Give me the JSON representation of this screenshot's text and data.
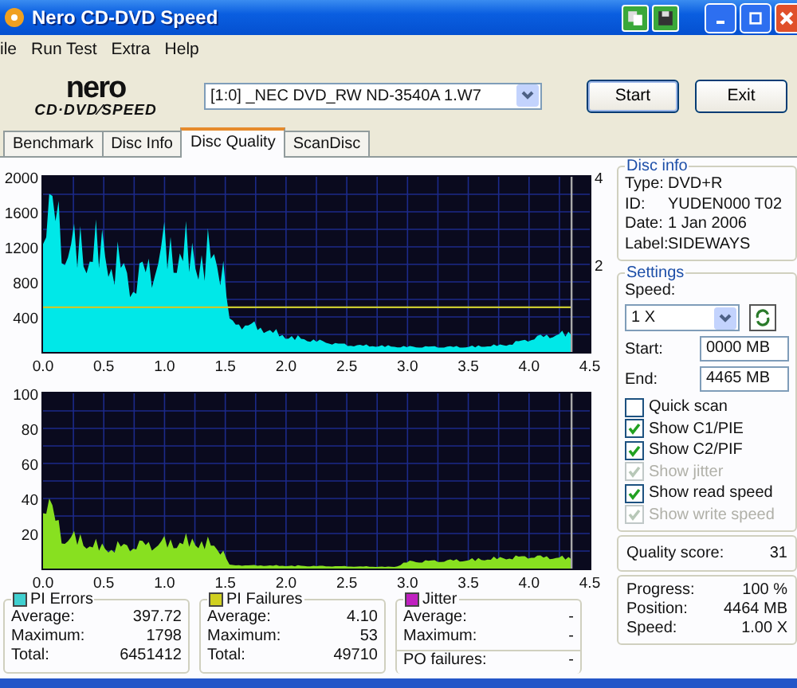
{
  "window": {
    "title": "Nero CD-DVD Speed"
  },
  "menu": [
    "ile",
    "Run Test",
    "Extra",
    "Help"
  ],
  "toolbar": {
    "logo_top": "nero",
    "logo_bottom": "CD·DVD⁄SPEED",
    "drive": "[1:0]  _NEC DVD_RW ND-3540A 1.W7",
    "buttons": [
      "Start",
      "Exit"
    ]
  },
  "tabs": [
    {
      "label": "Benchmark",
      "selected": false
    },
    {
      "label": "Disc Info",
      "selected": false
    },
    {
      "label": "Disc Quality",
      "selected": true
    },
    {
      "label": "ScanDisc",
      "selected": false
    }
  ],
  "graphs": [
    {
      "kind": "errors",
      "y_labels": [
        "2000",
        "1600",
        "1200",
        "800",
        "400"
      ],
      "right_labels": [
        "4",
        "2"
      ],
      "x_labels": [
        "0.0",
        "0.5",
        "1.0",
        "1.5",
        "2.0",
        "2.5",
        "3.0",
        "3.5",
        "4.0",
        "4.5"
      ]
    },
    {
      "kind": "failures",
      "y_labels": [
        "100",
        "80",
        "60",
        "40",
        "20"
      ],
      "x_labels": [
        "0.0",
        "0.5",
        "1.0",
        "1.5",
        "2.0",
        "2.5",
        "3.0",
        "3.5",
        "4.0",
        "4.5"
      ]
    }
  ],
  "stats": [
    {
      "title": "PI Errors",
      "color": "#40d0d0",
      "rows": [
        {
          "label": "Average:",
          "value": "397.72"
        },
        {
          "label": "Maximum:",
          "value": "1798"
        },
        {
          "label": "Total:",
          "value": "6451412"
        }
      ]
    },
    {
      "title": "PI Failures",
      "color": "#d0d020",
      "rows": [
        {
          "label": "Average:",
          "value": "4.10"
        },
        {
          "label": "Maximum:",
          "value": "53"
        },
        {
          "label": "Total:",
          "value": "49710"
        }
      ]
    },
    {
      "title": "Jitter",
      "color": "#c020c0",
      "rows": [
        {
          "label": "Average:",
          "value": "-"
        },
        {
          "label": "Maximum:",
          "value": "-"
        }
      ],
      "extra": {
        "label": "PO failures:",
        "value": "-"
      }
    }
  ],
  "disc_info": {
    "title": "Disc info",
    "rows": [
      {
        "label": "Type:",
        "value": "DVD+R"
      },
      {
        "label": "ID:",
        "value": "YUDEN000 T02"
      },
      {
        "label": "Date:",
        "value": "1 Jan 2006"
      },
      {
        "label": "Label:",
        "value": "SIDEWAYS"
      }
    ]
  },
  "settings": {
    "title": "Settings",
    "speed_label": "Speed:",
    "speed": "1 X",
    "start_label": "Start:",
    "start": "0000 MB",
    "end_label": "End:",
    "end": "4465 MB",
    "options": [
      {
        "label": "Quick scan",
        "checked": false,
        "disabled": false
      },
      {
        "label": "Show C1/PIE",
        "checked": true,
        "disabled": false
      },
      {
        "label": "Show C2/PIF",
        "checked": true,
        "disabled": false
      },
      {
        "label": "Show jitter",
        "checked": true,
        "disabled": true
      },
      {
        "label": "Show read speed",
        "checked": true,
        "disabled": false
      },
      {
        "label": "Show write speed",
        "checked": true,
        "disabled": true
      }
    ]
  },
  "quality": {
    "label": "Quality score:",
    "value": "31"
  },
  "progress": [
    {
      "label": "Progress:",
      "value": "100 %"
    },
    {
      "label": "Position:",
      "value": "4464 MB"
    },
    {
      "label": "Speed:",
      "value": "1.00 X"
    }
  ]
}
